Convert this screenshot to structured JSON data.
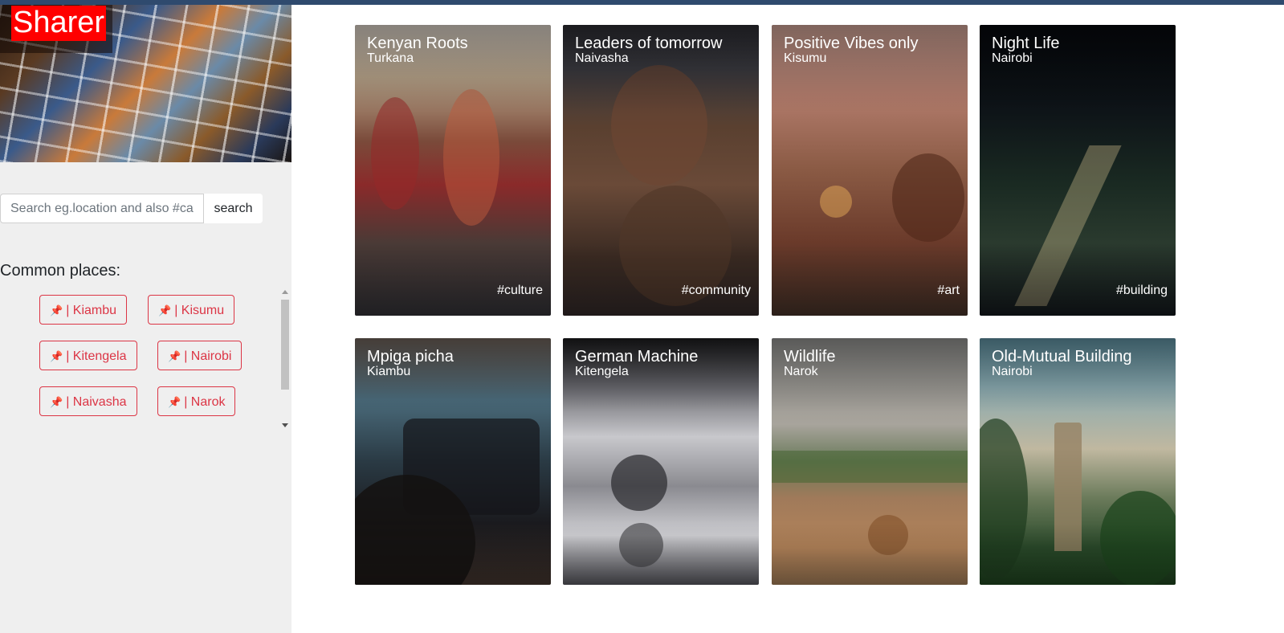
{
  "app": {
    "brand": "Sharer"
  },
  "search": {
    "placeholder": "Search eg.location and also #cat",
    "button_label": "search"
  },
  "common_places": {
    "title": "Common places:",
    "items": [
      {
        "pin": "📌",
        "label": "| Kiambu"
      },
      {
        "pin": "📌",
        "label": "| Kisumu"
      },
      {
        "pin": "📌",
        "label": "| Kitengela"
      },
      {
        "pin": "📌",
        "label": "| Nairobi"
      },
      {
        "pin": "📌",
        "label": "| Naivasha"
      },
      {
        "pin": "📌",
        "label": "| Narok"
      }
    ]
  },
  "photos": [
    {
      "title": "Kenyan Roots",
      "location": "Turkana",
      "tag": "#culture"
    },
    {
      "title": "Leaders of tomorrow",
      "location": "Naivasha",
      "tag": "#community"
    },
    {
      "title": "Positive Vibes only",
      "location": "Kisumu",
      "tag": "#art"
    },
    {
      "title": "Night Life",
      "location": "Nairobi",
      "tag": "#building"
    },
    {
      "title": "Mpiga picha",
      "location": "Kiambu",
      "tag": ""
    },
    {
      "title": "German Machine",
      "location": "Kitengela",
      "tag": ""
    },
    {
      "title": "Wildlife",
      "location": "Narok",
      "tag": ""
    },
    {
      "title": "Old-Mutual Building",
      "location": "Nairobi",
      "tag": ""
    }
  ],
  "colors": {
    "accent_red": "#dc3545",
    "brand_bg": "#ff0000",
    "topbar": "#2f4a6e",
    "sidebar_bg": "#efefef"
  }
}
